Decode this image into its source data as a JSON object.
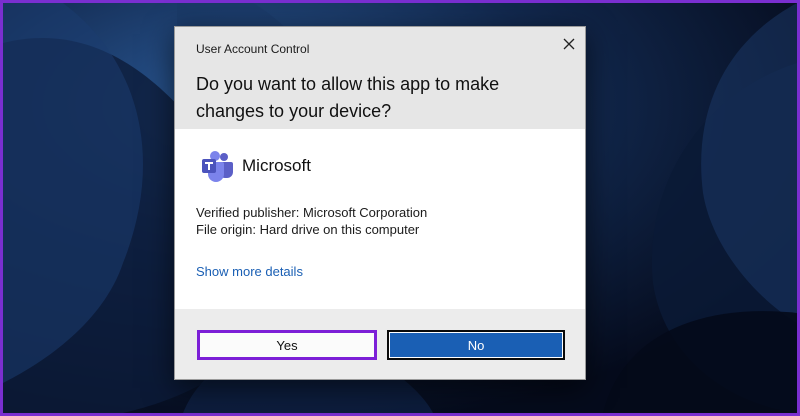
{
  "dialog": {
    "title": "User Account Control",
    "question": "Do you want to allow this app to make changes to your device?",
    "app_name": "Microsoft",
    "app_icon": "teams-logo-icon",
    "publisher": "Verified publisher: Microsoft Corporation",
    "origin": "File origin: Hard drive on this computer",
    "more_details": "Show more details",
    "close_icon": "close-icon"
  },
  "buttons": {
    "yes_label": "Yes",
    "no_label": "No"
  },
  "colors": {
    "accent": "#1a5fb4",
    "highlight": "#7c1fd7",
    "header_bg": "#e6e6e6",
    "footer_bg": "#ececec"
  }
}
